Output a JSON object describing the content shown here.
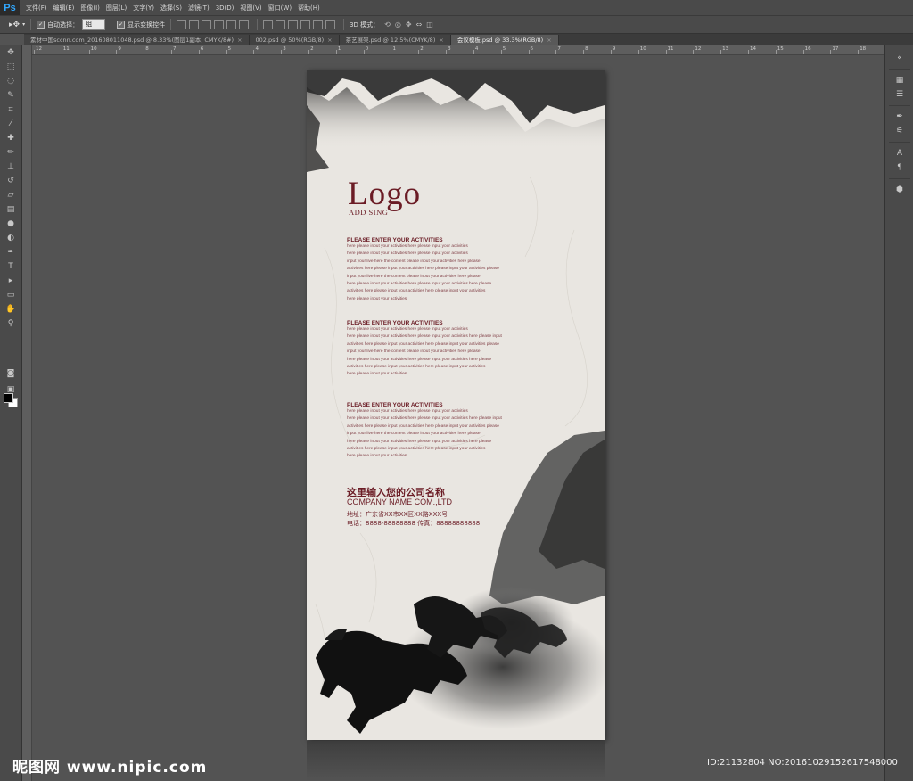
{
  "app": {
    "logo": "Ps"
  },
  "menu": [
    "文件(F)",
    "编辑(E)",
    "图像(I)",
    "图层(L)",
    "文字(Y)",
    "选择(S)",
    "滤镜(T)",
    "3D(D)",
    "视图(V)",
    "窗口(W)",
    "帮助(H)"
  ],
  "options": {
    "auto_select_label": "自动选择：",
    "auto_select_value": "组",
    "show_transform_label": "显示变换控件",
    "mode_3d_label": "3D 模式："
  },
  "tabs": [
    {
      "label": "素材中国sccnn.com_201608011048.psd @ 8.33%(图层1副本, CMYK/8#)",
      "active": false
    },
    {
      "label": "002.psd @ 50%(RGB/8)",
      "active": false
    },
    {
      "label": "茶艺展架.psd @ 12.5%(CMYK/8)",
      "active": false
    },
    {
      "label": "会议模板.psd @ 33.3%(RGB/8)",
      "active": true
    }
  ],
  "tab_close": "×",
  "ruler_top_ticks": [
    "12",
    "11",
    "10",
    "9",
    "8",
    "7",
    "6",
    "5",
    "4",
    "3",
    "2",
    "1",
    "0",
    "1",
    "2",
    "3",
    "4",
    "5",
    "6",
    "7",
    "8",
    "9",
    "10",
    "11",
    "12",
    "13",
    "14",
    "15",
    "16",
    "17",
    "18"
  ],
  "tools": [
    "move-tool",
    "marquee-tool",
    "lasso-tool",
    "quick-select-tool",
    "crop-tool",
    "eyedropper-tool",
    "spot-heal-tool",
    "brush-tool",
    "clone-stamp-tool",
    "history-brush-tool",
    "eraser-tool",
    "gradient-tool",
    "blur-tool",
    "dodge-tool",
    "pen-tool",
    "type-tool",
    "path-select-tool",
    "shape-tool",
    "hand-tool",
    "zoom-tool"
  ],
  "poster": {
    "logo": "Logo",
    "logo_sub": "ADD SING",
    "sections": [
      {
        "title": "PLEASE ENTER YOUR ACTIVITIES",
        "lines": [
          "here please input your activities here please input your activities",
          "here please input your activities here please input your activities",
          "input your live here the content please input your activities here please",
          "activities here please input your activities here please input your activities please",
          "input your live here the content please input your activities here please",
          "here please input your activities here please input your activities here please",
          "activities here please input your activities here please input your activities",
          "here please input your activities"
        ]
      },
      {
        "title": "PLEASE ENTER YOUR ACTIVITIES",
        "lines": [
          "here please input your activities here please input your activities",
          "here please input your activities here please input your activities here please input",
          "activities here please input your activities here please input your activities please",
          "input your live here the content please input your activities here please",
          "here please input your activities here please input your activities here please",
          "activities here please input your activities here please input your activities",
          "here please input your activities"
        ]
      },
      {
        "title": "PLEASE ENTER YOUR ACTIVITIES",
        "lines": [
          "here please input your activities here please input your activities",
          "here please input your activities here please input your activities here please input",
          "activities here please input your activities here please input your activities please",
          "input your live here the content please input your activities here please",
          "here please input your activities here please input your activities here please",
          "activities here please input your activities here please input your activities",
          "here please input your activities"
        ]
      }
    ],
    "company_cn": "这里输入您的公司名称",
    "company_en": "COMPANY NAME COM.,LTD",
    "address": "地址：广东省XX市XX区XX路XXX号",
    "phone": "电话：8888-88888888   传真：88888888888"
  },
  "watermark": {
    "left": "昵图网 www.nipic.com",
    "right": "ID:21132804 NO:20161029152617548000"
  },
  "colors": {
    "accent": "#6b1c25",
    "workspace": "#535353",
    "panel": "#4a4a4a"
  }
}
